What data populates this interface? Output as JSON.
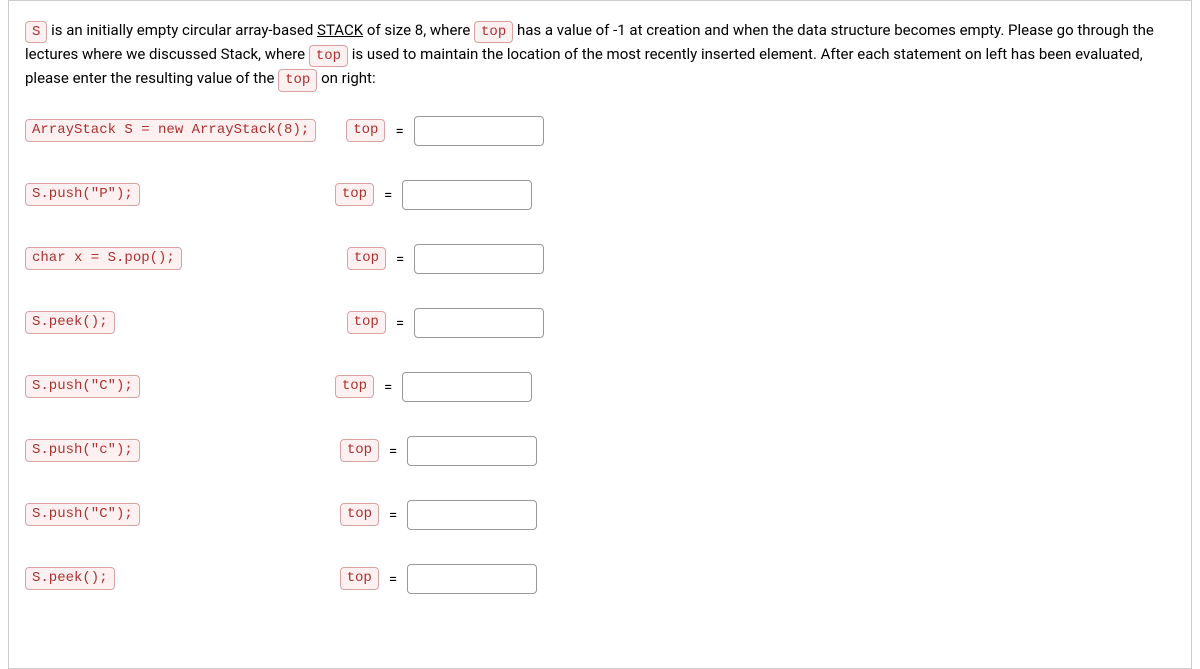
{
  "intro": {
    "p1a": " is an initially empty circular array-based ",
    "stack_word": "STACK",
    "p1b": " of size 8, where ",
    "p1c": " has a value of -1 at creation and when the data structure becomes empty. Please go through the lectures where we discussed Stack, where ",
    "p1d": " is used to maintain the location of the most recently inserted element. After each statement on left has been evaluated, please enter the resulting value of the ",
    "p1e": " on right:"
  },
  "tokens": {
    "s": "S",
    "top": "top"
  },
  "rows": [
    {
      "code": "ArrayStack S = new ArrayStack(8);",
      "label": "top",
      "eq": "=",
      "value": "",
      "off": "off0"
    },
    {
      "code": "S.push(\"P\");",
      "label": "top",
      "eq": "=",
      "value": "",
      "off": "off1"
    },
    {
      "code": "char x = S.pop();",
      "label": "top",
      "eq": "=",
      "value": "",
      "off": "off2"
    },
    {
      "code": "S.peek();",
      "label": "top",
      "eq": "=",
      "value": "",
      "off": "off3"
    },
    {
      "code": "S.push(\"C\");",
      "label": "top",
      "eq": "=",
      "value": "",
      "off": "off4"
    },
    {
      "code": "S.push(\"c\");",
      "label": "top",
      "eq": "=",
      "value": "",
      "off": "off5"
    },
    {
      "code": "S.push(\"C\");",
      "label": "top",
      "eq": "=",
      "value": "",
      "off": "off6"
    },
    {
      "code": "S.peek();",
      "label": "top",
      "eq": "=",
      "value": "",
      "off": "off7"
    }
  ]
}
